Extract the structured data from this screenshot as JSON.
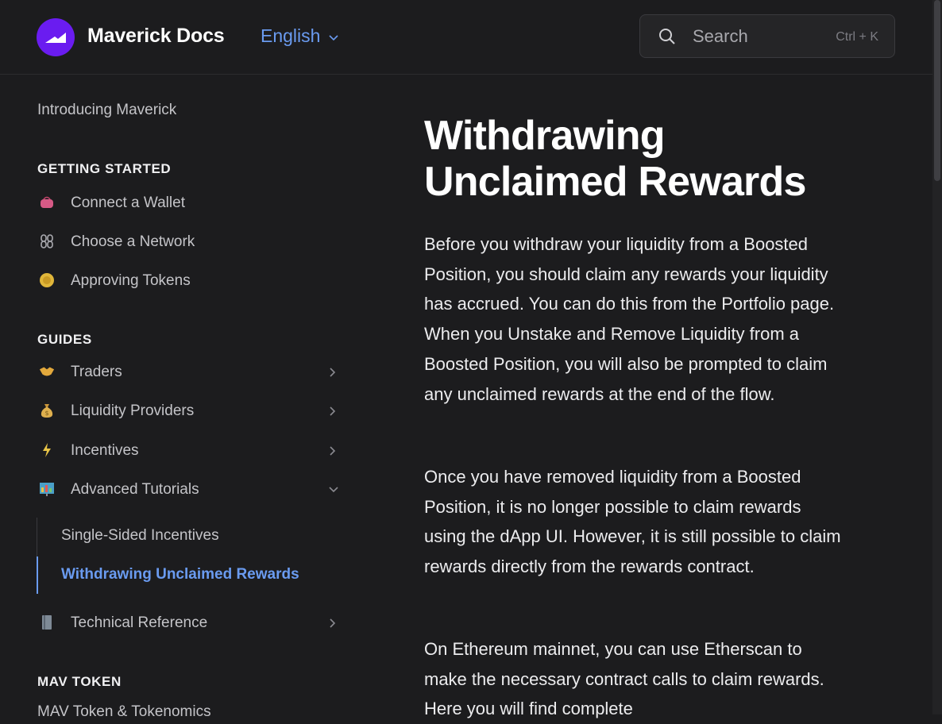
{
  "header": {
    "brand": "Maverick Docs",
    "language": "English",
    "search": {
      "placeholder": "Search",
      "shortcut": "Ctrl + K"
    }
  },
  "sidebar": {
    "intro": "Introducing Maverick",
    "getting_started": {
      "title": "GETTING STARTED",
      "items": [
        {
          "label": "Connect a Wallet",
          "icon": "purse-icon"
        },
        {
          "label": "Choose a Network",
          "icon": "chain-icon"
        },
        {
          "label": "Approving Tokens",
          "icon": "coin-icon"
        }
      ]
    },
    "guides": {
      "title": "GUIDES",
      "items": [
        {
          "label": "Traders",
          "icon": "handshake-icon"
        },
        {
          "label": "Liquidity Providers",
          "icon": "money-bag-icon"
        },
        {
          "label": "Incentives",
          "icon": "lightning-icon"
        },
        {
          "label": "Advanced Tutorials",
          "icon": "chart-icon"
        }
      ],
      "sub_items": [
        {
          "label": "Single-Sided Incentives"
        },
        {
          "label": "Withdrawing Unclaimed Rewards"
        }
      ],
      "after": {
        "label": "Technical Reference",
        "icon": "book-icon"
      }
    },
    "mav_token": {
      "title": "MAV TOKEN",
      "items": [
        {
          "label": "MAV Token & Tokenomics"
        }
      ]
    }
  },
  "main": {
    "title_line1": "Withdrawing",
    "title_line2": "Unclaimed Rewards",
    "paragraphs": [
      "Before you withdraw your liquidity from a Boosted Position, you should claim any rewards your liquidity has accrued. You can do this from the Portfolio page. When you Unstake and Remove Liquidity from a Boosted Position, you will also be prompted to claim any unclaimed rewards at the end of the flow.",
      "Once you have removed liquidity from a Boosted Position, it is no longer possible to claim rewards using the dApp UI. However, it is still possible to claim rewards directly from the rewards contract.",
      "On Ethereum mainnet, you can use Etherscan to make the necessary contract calls to claim rewards. Here you will find complete"
    ]
  },
  "colors": {
    "background": "#1c1c1e",
    "accent": "#6a9bf0",
    "logo": "#6a1cf0"
  }
}
